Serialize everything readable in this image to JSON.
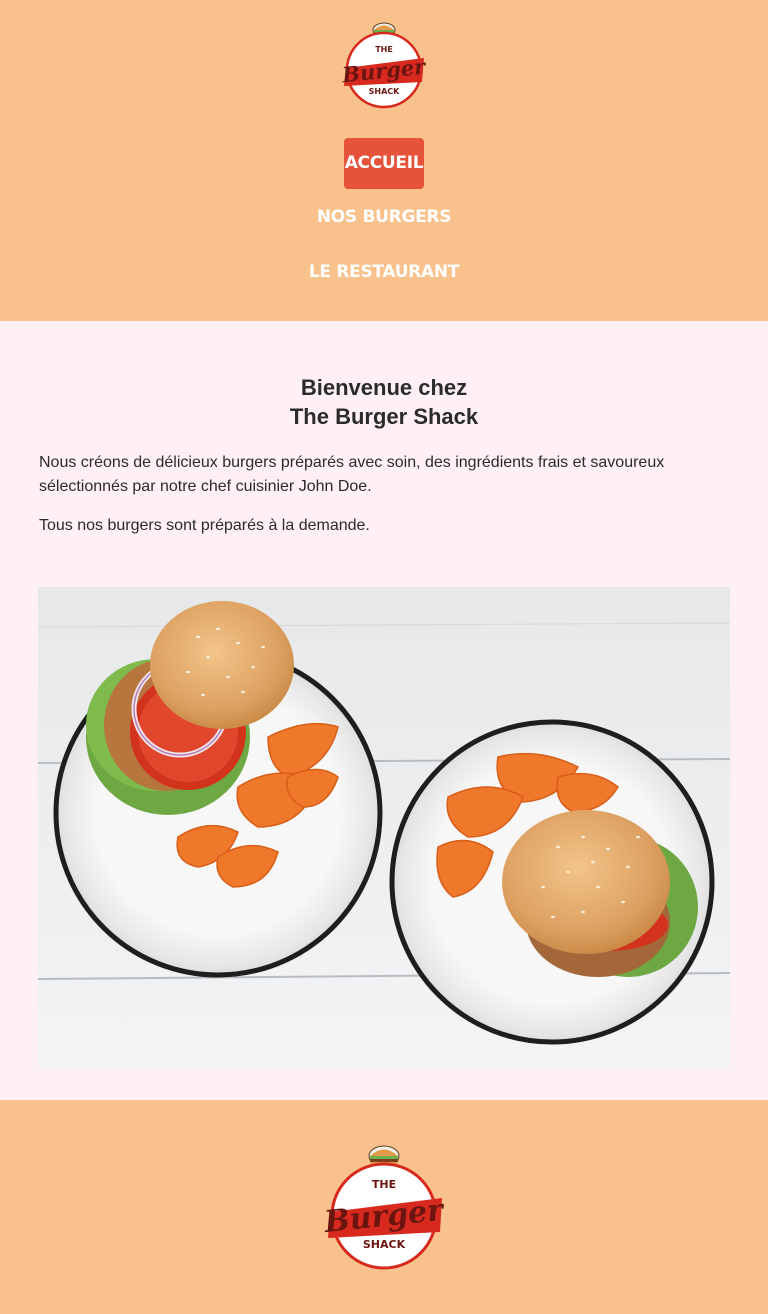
{
  "brand": {
    "logo": {
      "top": "THE",
      "middle": "Burger",
      "bottom": "SHACK"
    },
    "colors": {
      "header_bg": "#f9c28d",
      "accent": "#e5533b",
      "page_bg": "#fef0f4",
      "logo_red": "#d8291f",
      "logo_dark": "#6b1510"
    }
  },
  "nav": {
    "items": [
      {
        "label": "Accueil",
        "active": true
      },
      {
        "label": "Nos burgers",
        "active": false
      },
      {
        "label": "Le restaurant",
        "active": false
      }
    ]
  },
  "main": {
    "title_line1": "Bienvenue chez",
    "title_line2": "The Burger Shack",
    "paragraph1": "Nous créons de délicieux burgers préparés avec soin, des ingrédients frais et savoureux sélectionnés par notre chef cuisinier John Doe.",
    "paragraph2": "Tous nos burgers sont préparés à la demande."
  },
  "footer": {
    "logo": {
      "top": "THE",
      "middle": "Burger",
      "bottom": "SHACK"
    }
  }
}
